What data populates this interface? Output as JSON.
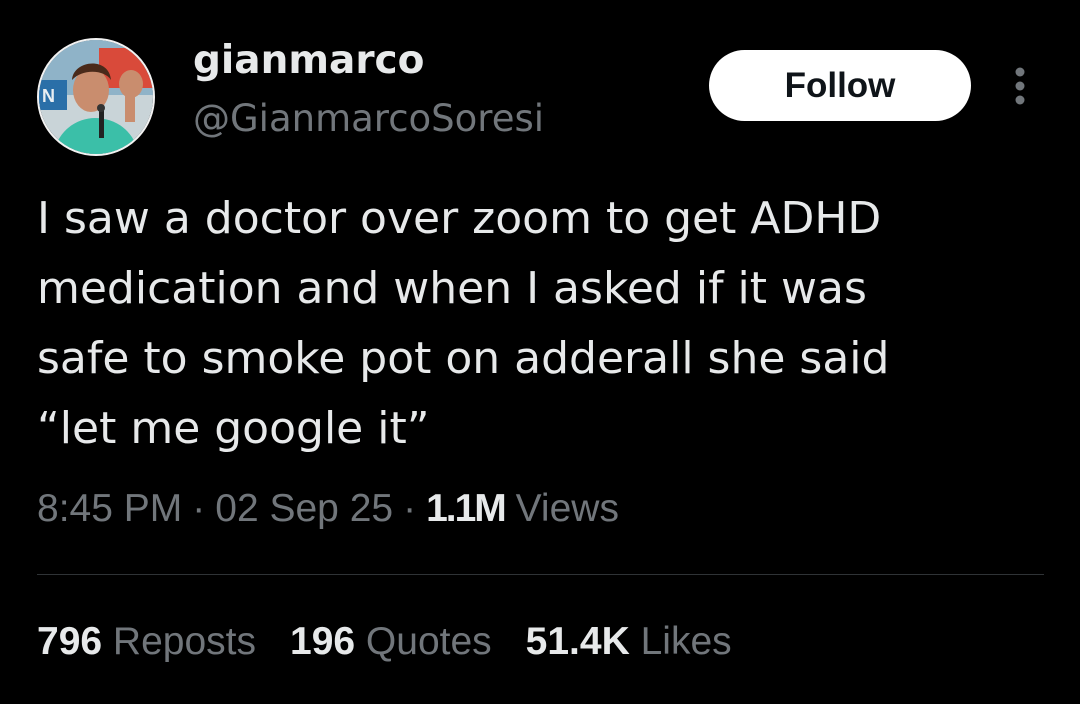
{
  "author": {
    "display_name": "gianmarco",
    "handle": "@GianmarcoSoresi"
  },
  "follow_label": "Follow",
  "tweet": {
    "text": "I saw a doctor over zoom to get ADHD\nmedication and when I asked if it was\nsafe to smoke pot on adderall she said\n“let me google it”"
  },
  "meta": {
    "time": "8:45 PM",
    "date": "02 Sep 25",
    "separator": "·",
    "views_count": "1.1M",
    "views_label": "Views"
  },
  "stats": [
    {
      "count": "796",
      "label": "Reposts"
    },
    {
      "count": "196",
      "label": "Quotes"
    },
    {
      "count": "51.4K",
      "label": "Likes"
    }
  ],
  "icons": {
    "more": "more-horizontal-dots-icon"
  },
  "colors": {
    "background": "#000000",
    "primary_text": "#e7e9ea",
    "secondary_text": "#71767b",
    "follow_button_bg": "#ffffff",
    "follow_button_text": "#0f1419",
    "divider": "#2f3336"
  }
}
